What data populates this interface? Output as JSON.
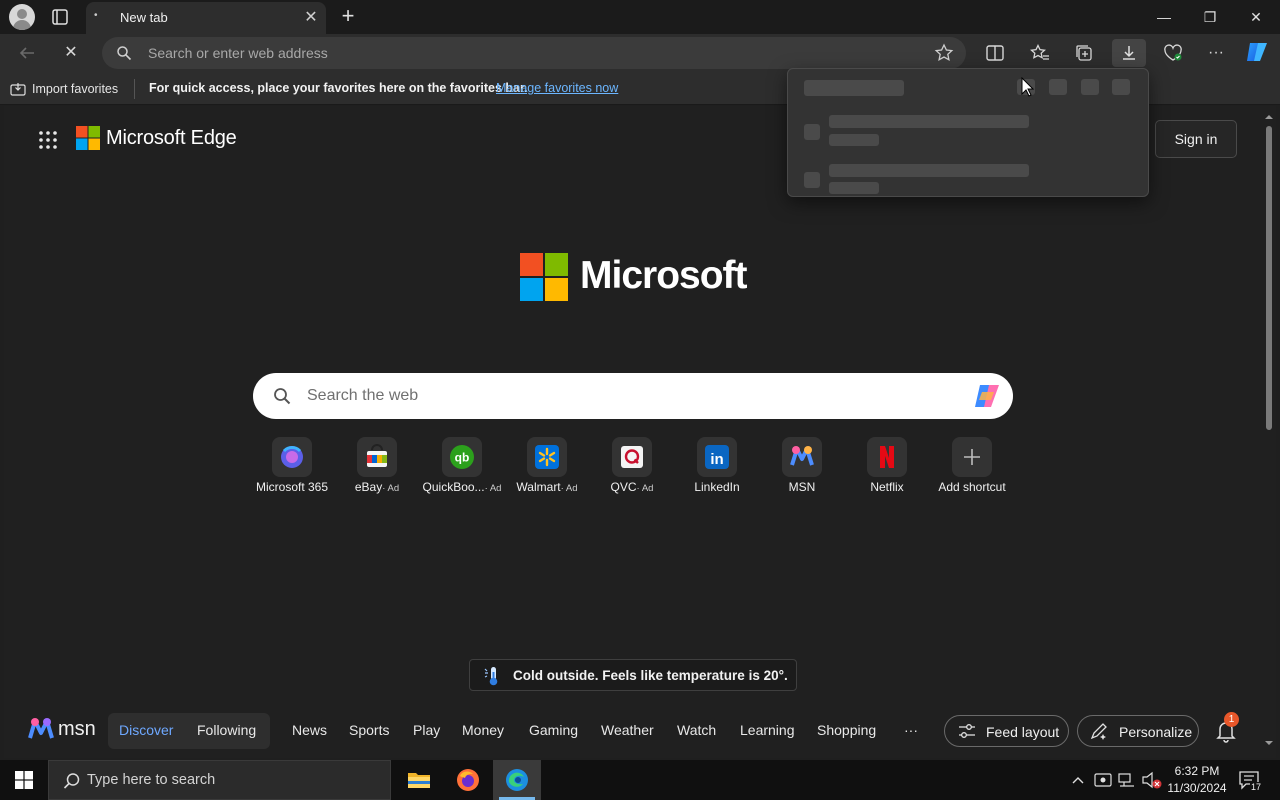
{
  "browser": {
    "tab": {
      "title": "New tab",
      "dot": "•"
    },
    "address": {
      "placeholder": "Search or enter web address"
    },
    "favorites_bar": {
      "import_label": "Import favorites",
      "message": "For quick access, place your favorites here on the favorites bar.",
      "link": "Manage favorites now"
    },
    "window_controls": {
      "minimize": "—",
      "restore": "❐",
      "close": "✕"
    }
  },
  "newtab": {
    "brand": "Microsoft Edge",
    "signin_label": "Sign in",
    "hero_brand": "Microsoft",
    "search": {
      "placeholder": "Search the web"
    },
    "shortcuts": [
      {
        "label": "Microsoft 365",
        "ad": ""
      },
      {
        "label": "eBay",
        "ad": "· Ad"
      },
      {
        "label": "QuickBoo...",
        "ad": "· Ad"
      },
      {
        "label": "Walmart",
        "ad": "· Ad"
      },
      {
        "label": "QVC",
        "ad": "· Ad"
      },
      {
        "label": "LinkedIn",
        "ad": ""
      },
      {
        "label": "MSN",
        "ad": ""
      },
      {
        "label": "Netflix",
        "ad": ""
      },
      {
        "label": "Add shortcut",
        "ad": ""
      }
    ],
    "weather": {
      "text": "Cold outside. Feels like temperature is 20°."
    },
    "msn": {
      "logo_text": "msn",
      "tabs": {
        "discover": "Discover",
        "following": "Following"
      },
      "nav": [
        "News",
        "Sports",
        "Play",
        "Money",
        "Gaming",
        "Weather",
        "Watch",
        "Learning",
        "Shopping",
        "···"
      ],
      "feed_layout": "Feed layout",
      "personalize": "Personalize",
      "notification_count": "1"
    }
  },
  "taskbar": {
    "search_placeholder": "Type here to search",
    "time": "6:32 PM",
    "date": "11/30/2024",
    "notification_count": "17"
  },
  "colors": {
    "accent_link": "#6cb6ff",
    "discover_blue": "#6ea8ff",
    "badge_orange": "#e8572a",
    "ms_red": "#f25022",
    "ms_green": "#7fba00",
    "ms_blue": "#00a4ef",
    "ms_yellow": "#ffb900"
  }
}
